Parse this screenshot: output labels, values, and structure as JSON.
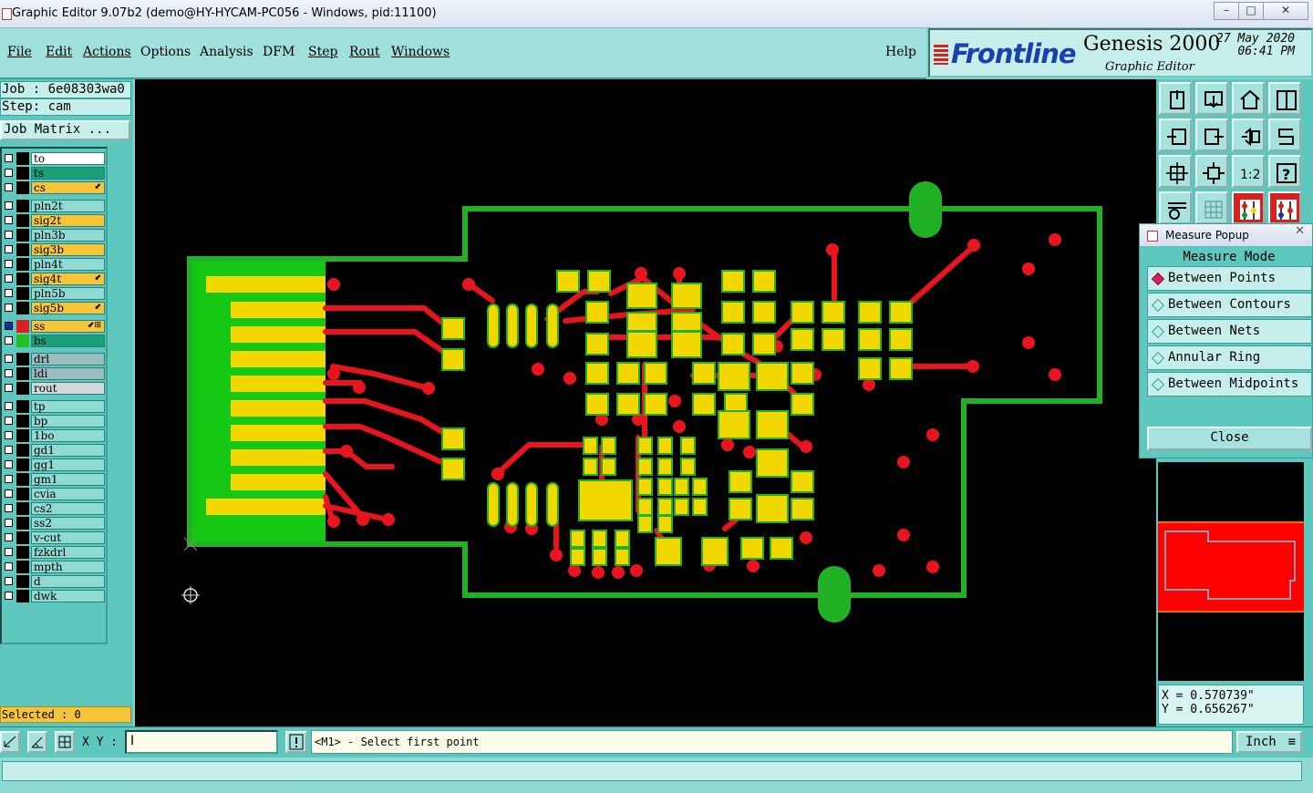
{
  "window": {
    "title": "Graphic Editor 9.07b2 (demo@HY-HYCAM-PC056 - Windows, pid:11100)"
  },
  "menu": {
    "file": "File",
    "edit": "Edit",
    "actions": "Actions",
    "options": "Options",
    "analysis": "Analysis",
    "dfm": "DFM",
    "step": "Step",
    "rout": "Rout",
    "windows": "Windows",
    "help": "Help"
  },
  "brand": {
    "logo": "Frontline",
    "product": "Genesis 2000",
    "subtitle": "Graphic Editor",
    "date": "27 May 2020",
    "time": "06:41 PM"
  },
  "job": {
    "job_line": "Job : 6e08303wa0",
    "step_line": "Step: cam",
    "matrix_button": "Job Matrix ..."
  },
  "layers": [
    {
      "name": "to",
      "color": "#ffffff",
      "box": "#000000"
    },
    {
      "name": "ts",
      "color": "#1aa078",
      "box": "#000000"
    },
    {
      "name": "cs",
      "color": "#f6c53a",
      "box": "#000000",
      "mark": "⬋"
    },
    {
      "name": "pln2t",
      "color": "#8fdad3",
      "box": "#000000"
    },
    {
      "name": "sig2t",
      "color": "#f6c53a",
      "box": "#000000"
    },
    {
      "name": "pln3b",
      "color": "#8fdad3",
      "box": "#000000"
    },
    {
      "name": "sig3b",
      "color": "#f6c53a",
      "box": "#000000"
    },
    {
      "name": "pln4t",
      "color": "#8fdad3",
      "box": "#000000"
    },
    {
      "name": "sig4t",
      "color": "#f6c53a",
      "box": "#000000",
      "mark": "⬋"
    },
    {
      "name": "pln5b",
      "color": "#8fdad3",
      "box": "#000000"
    },
    {
      "name": "sig5b",
      "color": "#f6c53a",
      "box": "#000000",
      "mark": "⬋"
    },
    {
      "name": "ss",
      "color": "#f6c53a",
      "box": "#d8201e",
      "mark": "⬋⊞"
    },
    {
      "name": "bs",
      "color": "#1aa078",
      "box": "#22c020"
    },
    {
      "name": "drl",
      "color": "#9bbcbc",
      "box": "#000000"
    },
    {
      "name": "ldi",
      "color": "#9bbcbc",
      "box": "#000000"
    },
    {
      "name": "rout",
      "color": "#d4dada",
      "box": "#000000"
    },
    {
      "name": "tp",
      "color": "#8fdad3",
      "box": "#000000"
    },
    {
      "name": "bp",
      "color": "#8fdad3",
      "box": "#000000"
    },
    {
      "name": "1bo",
      "color": "#8fdad3",
      "box": "#000000"
    },
    {
      "name": "gd1",
      "color": "#8fdad3",
      "box": "#000000"
    },
    {
      "name": "gg1",
      "color": "#8fdad3",
      "box": "#000000"
    },
    {
      "name": "gm1",
      "color": "#8fdad3",
      "box": "#000000"
    },
    {
      "name": "cvia",
      "color": "#8fdad3",
      "box": "#000000"
    },
    {
      "name": "cs2",
      "color": "#8fdad3",
      "box": "#000000"
    },
    {
      "name": "ss2",
      "color": "#8fdad3",
      "box": "#000000"
    },
    {
      "name": "v-cut",
      "color": "#8fdad3",
      "box": "#000000"
    },
    {
      "name": "fzkdrl",
      "color": "#8fdad3",
      "box": "#000000"
    },
    {
      "name": "mpth",
      "color": "#8fdad3",
      "box": "#000000"
    },
    {
      "name": "d",
      "color": "#8fdad3",
      "box": "#000000"
    },
    {
      "name": "dwk",
      "color": "#8fdad3",
      "box": "#000000"
    }
  ],
  "selected": "Selected : 0",
  "measure_popup": {
    "title": "Measure Popup",
    "header": "Measure Mode",
    "options": [
      "Between Points",
      "Between Contours",
      "Between Nets",
      "Annular Ring",
      "Between Midpoints"
    ],
    "close": "Close"
  },
  "coords": {
    "x": "X = 0.570739\"",
    "y": "Y = 0.656267\""
  },
  "status": {
    "xy_label": "X Y :",
    "message": "<M1> - Select first point",
    "unit": "Inch"
  },
  "colors": {
    "outline": "#22b024",
    "pad": "#f2d800",
    "trace": "#e8141e",
    "panel": "#5ec8bf"
  }
}
